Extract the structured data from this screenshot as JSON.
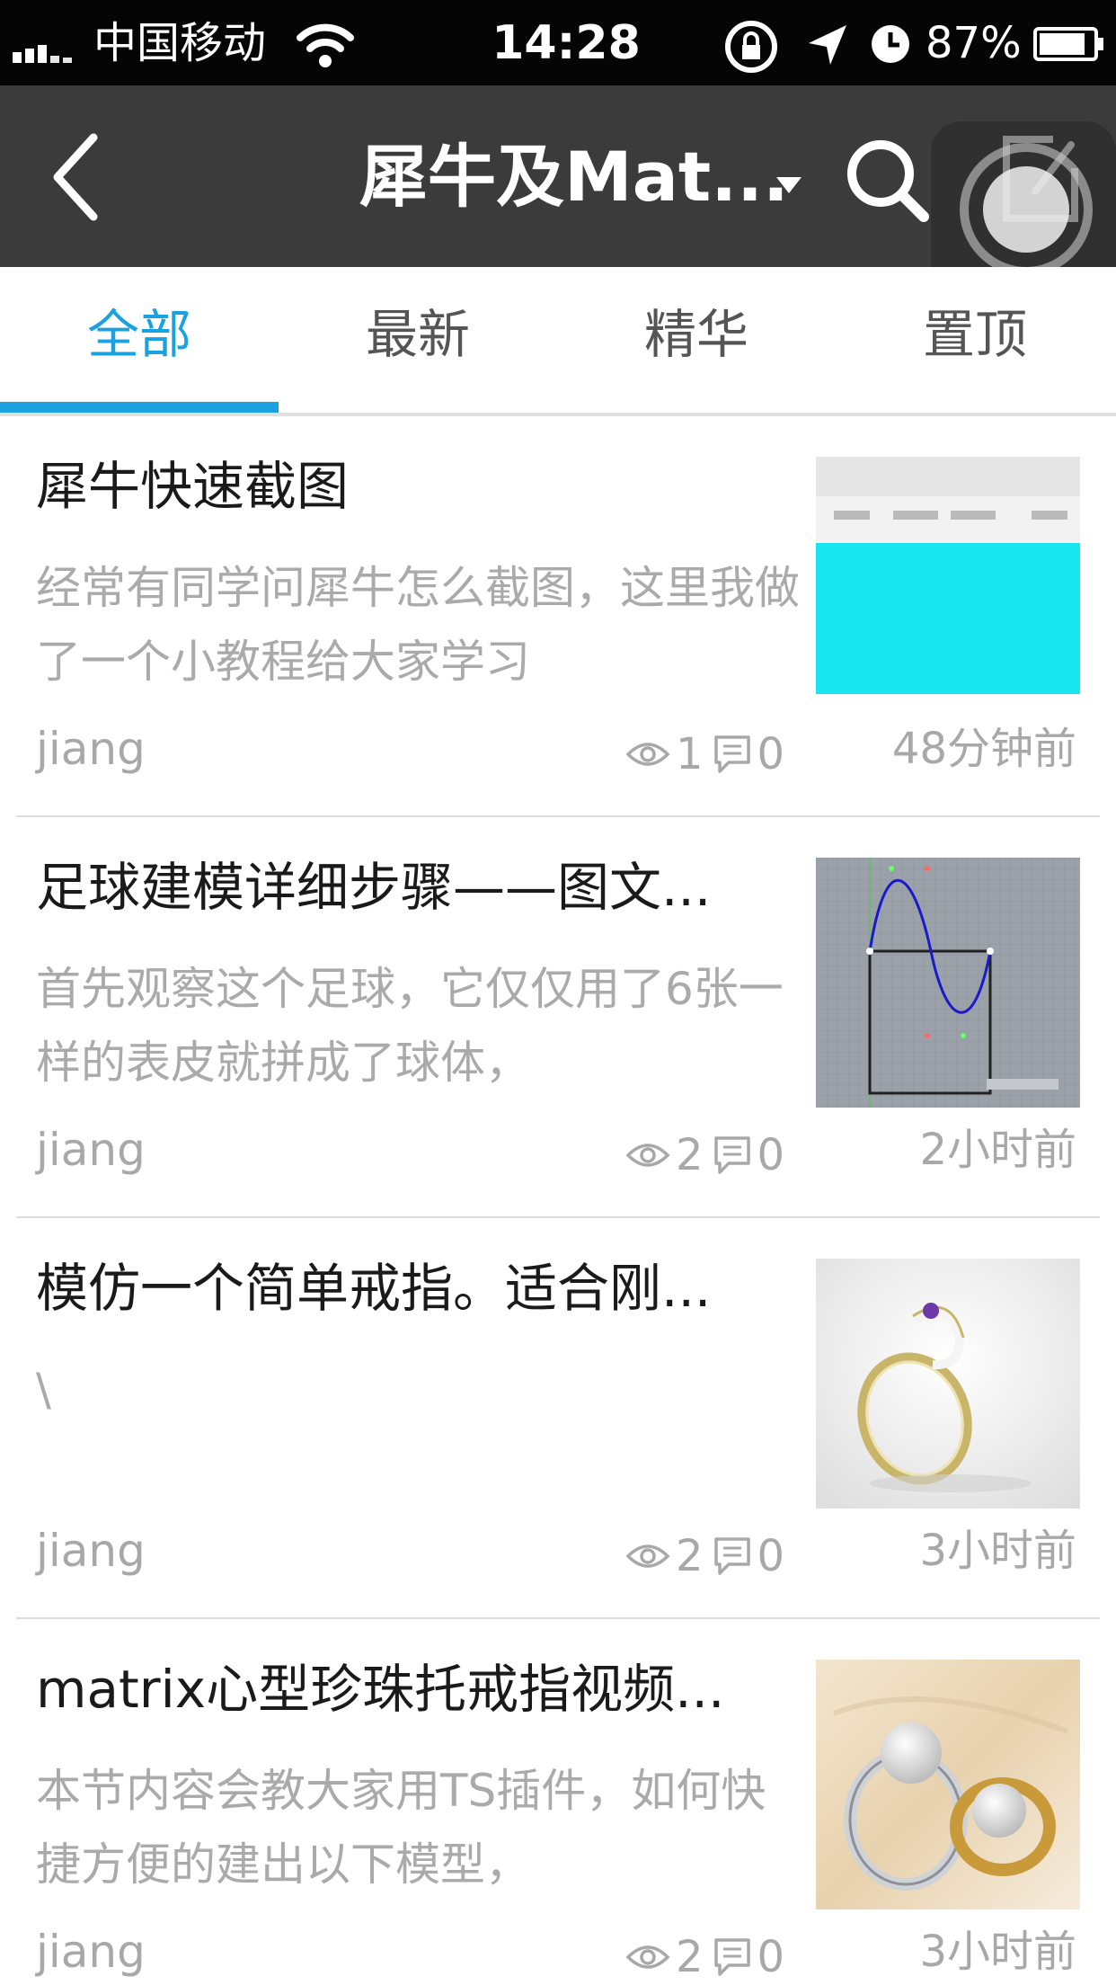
{
  "status_bar": {
    "carrier": "中国移动",
    "time": "14:28",
    "battery": "87%"
  },
  "nav": {
    "title": "犀牛及Mat..."
  },
  "tabs": [
    {
      "label": "全部",
      "active": true
    },
    {
      "label": "最新",
      "active": false
    },
    {
      "label": "精华",
      "active": false
    },
    {
      "label": "置顶",
      "active": false
    }
  ],
  "posts": [
    {
      "title": "犀牛快速截图",
      "desc": "经常有同学问犀牛怎么截图，这里我做了一个小教程给大家学习",
      "author": "jiang",
      "views": "1",
      "comments": "0",
      "time": "48分钟前",
      "thumb": "screenshot-toolbar"
    },
    {
      "title": "足球建模详细步骤——图文...",
      "desc": "首先观察这个足球，它仅仅用了6张一样的表皮就拼成了球体，",
      "author": "jiang",
      "views": "2",
      "comments": "0",
      "time": "2小时前",
      "thumb": "curve-drawing"
    },
    {
      "title": "模仿一个简单戒指。适合刚...",
      "desc": "\\",
      "author": "jiang",
      "views": "2",
      "comments": "0",
      "time": "3小时前",
      "thumb": "gold-ring"
    },
    {
      "title": "matrix心型珍珠托戒指视频...",
      "desc": "本节内容会教大家用TS插件，如何快捷方便的建出以下模型，",
      "author": "jiang",
      "views": "2",
      "comments": "0",
      "time": "3小时前",
      "thumb": "pearl-rings"
    }
  ],
  "colors": {
    "accent": "#1aa2e0",
    "navbar": "#3b3b3b",
    "statusbar": "#050505"
  }
}
